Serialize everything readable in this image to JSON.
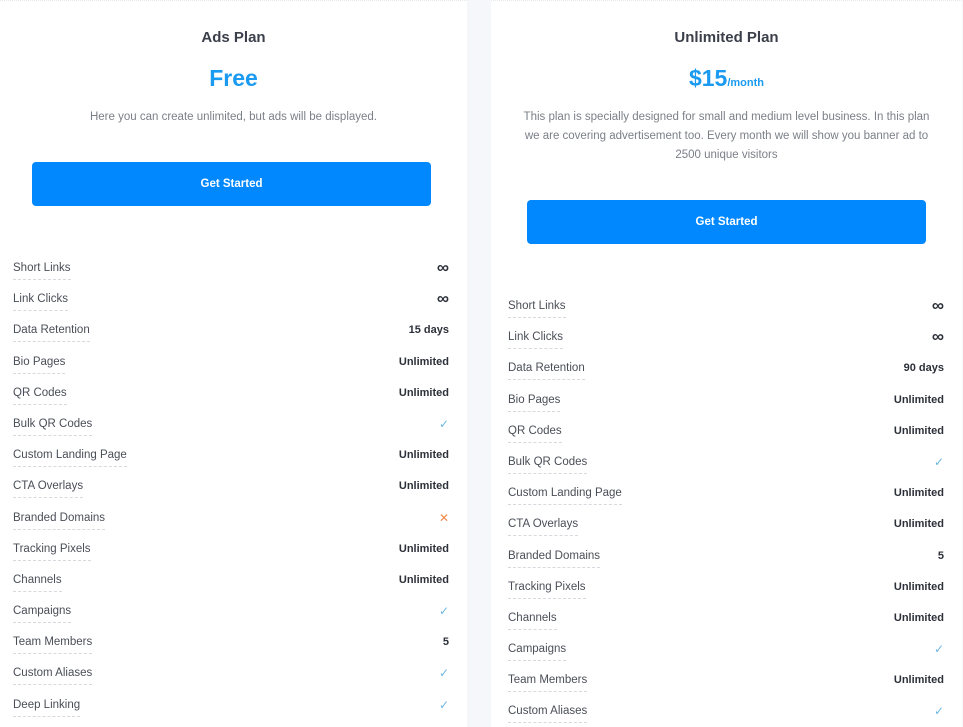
{
  "colors": {
    "accent": "#0188ff",
    "price": "#1a9af0",
    "check": "#6cb8e2",
    "cross": "#f08a4b",
    "background": "#f5f7fb"
  },
  "plans": [
    {
      "title": "Ads Plan",
      "price": "Free",
      "period": "",
      "description": "Here you can create unlimited, but ads will be displayed.",
      "cta_label": "Get Started",
      "features": [
        {
          "label": "Short Links",
          "type": "infinity",
          "value": "∞"
        },
        {
          "label": "Link Clicks",
          "type": "infinity",
          "value": "∞"
        },
        {
          "label": "Data Retention",
          "type": "text",
          "value": "15 days"
        },
        {
          "label": "Bio Pages",
          "type": "text",
          "value": "Unlimited"
        },
        {
          "label": "QR Codes",
          "type": "text",
          "value": "Unlimited"
        },
        {
          "label": "Bulk QR Codes",
          "type": "check",
          "value": "✓"
        },
        {
          "label": "Custom Landing Page",
          "type": "text",
          "value": "Unlimited"
        },
        {
          "label": "CTA Overlays",
          "type": "text",
          "value": "Unlimited"
        },
        {
          "label": "Branded Domains",
          "type": "cross",
          "value": "✕"
        },
        {
          "label": "Tracking Pixels",
          "type": "text",
          "value": "Unlimited"
        },
        {
          "label": "Channels",
          "type": "text",
          "value": "Unlimited"
        },
        {
          "label": "Campaigns",
          "type": "check",
          "value": "✓"
        },
        {
          "label": "Team Members",
          "type": "text",
          "value": "5"
        },
        {
          "label": "Custom Aliases",
          "type": "check",
          "value": "✓"
        },
        {
          "label": "Deep Linking",
          "type": "check",
          "value": "✓"
        }
      ]
    },
    {
      "title": "Unlimited Plan",
      "price": "$15",
      "period": "/month",
      "description": "This plan is specially designed for small and medium level business. In this plan we are covering advertisement too. Every month we will show you banner ad to 2500 unique visitors",
      "cta_label": "Get Started",
      "features": [
        {
          "label": "Short Links",
          "type": "infinity",
          "value": "∞"
        },
        {
          "label": "Link Clicks",
          "type": "infinity",
          "value": "∞"
        },
        {
          "label": "Data Retention",
          "type": "text",
          "value": "90 days"
        },
        {
          "label": "Bio Pages",
          "type": "text",
          "value": "Unlimited"
        },
        {
          "label": "QR Codes",
          "type": "text",
          "value": "Unlimited"
        },
        {
          "label": "Bulk QR Codes",
          "type": "check",
          "value": "✓"
        },
        {
          "label": "Custom Landing Page",
          "type": "text",
          "value": "Unlimited"
        },
        {
          "label": "CTA Overlays",
          "type": "text",
          "value": "Unlimited"
        },
        {
          "label": "Branded Domains",
          "type": "text",
          "value": "5"
        },
        {
          "label": "Tracking Pixels",
          "type": "text",
          "value": "Unlimited"
        },
        {
          "label": "Channels",
          "type": "text",
          "value": "Unlimited"
        },
        {
          "label": "Campaigns",
          "type": "check",
          "value": "✓"
        },
        {
          "label": "Team Members",
          "type": "text",
          "value": "Unlimited"
        },
        {
          "label": "Custom Aliases",
          "type": "check",
          "value": "✓"
        }
      ]
    }
  ]
}
